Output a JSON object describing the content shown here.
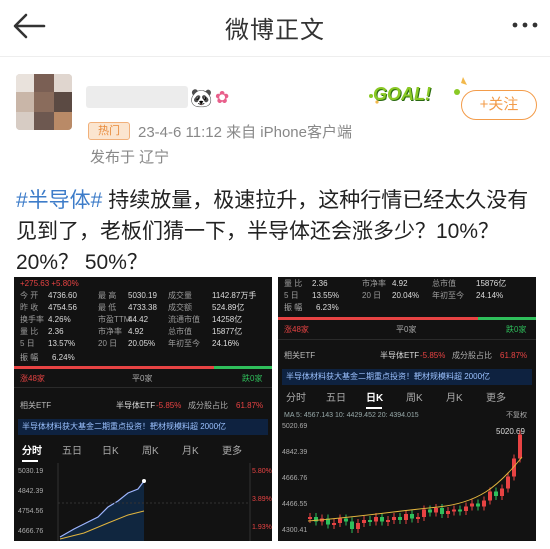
{
  "header": {
    "title": "微博正文"
  },
  "post": {
    "follow_label": "+关注",
    "badge": "热门",
    "date_source": "23-4-6 11:12  来自 iPhone客户端",
    "location": "发布于 辽宁",
    "goal_text": "GOAL!",
    "tag": "#半导体#",
    "text": " 持续放量，极速拉升，这种行情已经太久没有见到了，老板们猜一下，半导体还会涨多少？10%？ 20%？ 50%？"
  },
  "shot1": {
    "change": "+275.63  +5.80%",
    "rows": [
      [
        "今 开",
        "4736.60",
        "最 高",
        "5030.19",
        "成交量",
        "1142.87万手"
      ],
      [
        "昨 收",
        "4754.56",
        "最 低",
        "4733.38",
        "成交额",
        "524.89亿"
      ],
      [
        "换手率",
        "4.26%",
        "市盈TTM",
        "44.42",
        "流通市值",
        "14258亿"
      ],
      [
        "量 比",
        "2.36",
        "市净率",
        "4.92",
        "总市值",
        "15877亿"
      ],
      [
        "5 日",
        "13.57%",
        "20 日",
        "20.05%",
        "年初至今",
        "24.16%"
      ]
    ],
    "amplitude": "振 幅",
    "amplitude_value": "6.24%",
    "up": "涨48家",
    "flat": "平0家",
    "down": "跌0家",
    "etf_label": "相关ETF",
    "etf_name": "半导体ETF",
    "etf_change": "-5.85%",
    "etf_pct_label": "成分股占比",
    "etf_pct": "61.87%",
    "ad": "半导体材料获大基金二期重点投资！靶材规模料超 2000亿",
    "tabs": [
      "分时",
      "五日",
      "日K",
      "周K",
      "月K",
      "更多"
    ],
    "y_labels": [
      "5030.19",
      "4842.39",
      "4754.56",
      "4666.76"
    ],
    "right_labels": [
      "5.80%",
      "3.89%",
      "1.93%"
    ]
  },
  "shot2": {
    "rows": [
      [
        "量 比",
        "2.36",
        "市净率",
        "4.92",
        "总市值",
        "15876亿"
      ],
      [
        "5 日",
        "13.55%",
        "20 日",
        "20.04%",
        "年初至今",
        "24.14%"
      ]
    ],
    "amplitude": "振 幅",
    "amplitude_value": "6.23%",
    "up": "涨48家",
    "flat": "平0家",
    "down": "跌0家",
    "etf_label": "相关ETF",
    "etf_name": "半导体ETF",
    "etf_change": "-5.85%",
    "etf_pct_label": "成分股占比",
    "etf_pct": "61.87%",
    "ad": "半导体材料获大基金二期重点投资！靶材规模料超 2000亿",
    "tabs": [
      "分时",
      "五日",
      "日K",
      "周K",
      "月K",
      "更多"
    ],
    "ma_line": "MA  5: 4567.143   10: 4429.452   20: 4394.015",
    "rehab": "不复权",
    "price_right": "5020.69",
    "y_labels": [
      "5020.69",
      "4842.39",
      "4666.76",
      "4466.55",
      "4300.41"
    ]
  },
  "colors": {
    "accent": "#f39c4a",
    "link": "#3d7cc9",
    "up": "#e84343",
    "down": "#2fbf5b"
  }
}
